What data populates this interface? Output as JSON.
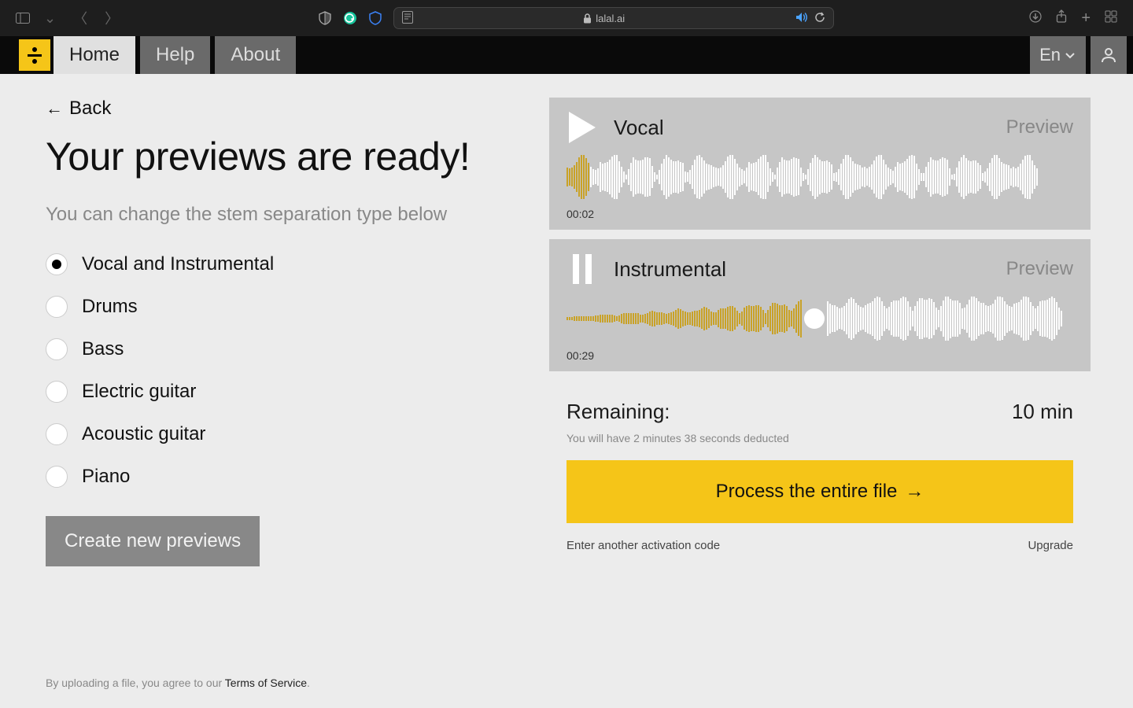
{
  "browser": {
    "url_domain": "lalal.ai"
  },
  "nav": {
    "items": [
      {
        "label": "Home",
        "active": true
      },
      {
        "label": "Help",
        "active": false
      },
      {
        "label": "About",
        "active": false
      }
    ],
    "language": "En"
  },
  "back": {
    "label": "Back"
  },
  "headline": "Your previews are ready!",
  "subhead": "You can change the stem separation type below",
  "stems": {
    "options": [
      {
        "label": "Vocal and Instrumental",
        "selected": true
      },
      {
        "label": "Drums",
        "selected": false
      },
      {
        "label": "Bass",
        "selected": false
      },
      {
        "label": "Electric guitar",
        "selected": false
      },
      {
        "label": "Acoustic guitar",
        "selected": false
      },
      {
        "label": "Piano",
        "selected": false
      }
    ]
  },
  "create_btn": "Create new previews",
  "tos": {
    "prefix": "By uploading a file, you agree to our ",
    "link": "Terms of Service",
    "suffix": "."
  },
  "tracks": [
    {
      "name": "Vocal",
      "tag": "Preview",
      "time": "00:02",
      "playing": false,
      "progress_pct": 5
    },
    {
      "name": "Instrumental",
      "tag": "Preview",
      "time": "00:29",
      "playing": true,
      "progress_pct": 50
    }
  ],
  "remaining": {
    "label": "Remaining:",
    "value": "10 min",
    "note": "You will have 2 minutes 38 seconds deducted"
  },
  "process_btn": "Process the entire file",
  "bottom": {
    "activation": "Enter another activation code",
    "upgrade": "Upgrade"
  }
}
